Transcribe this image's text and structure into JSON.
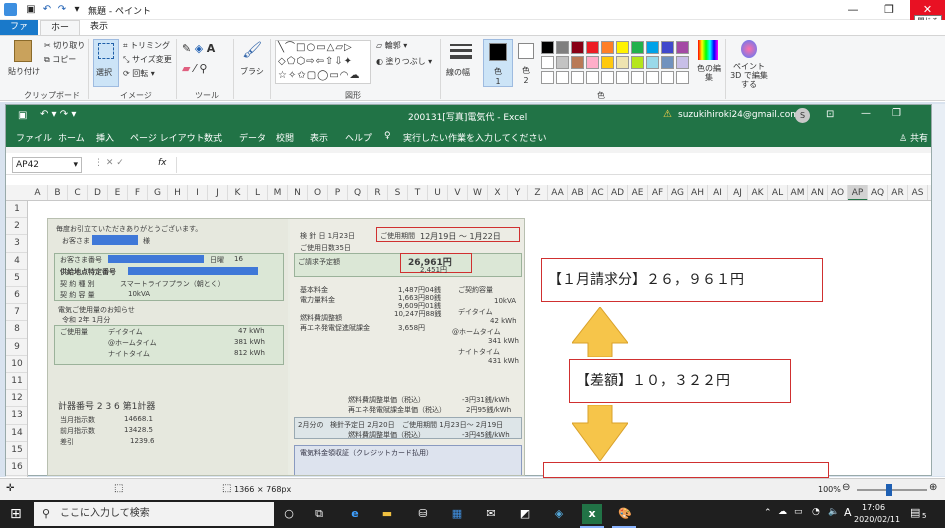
{
  "paint": {
    "title": "無題 - ペイント",
    "close_tooltip": "閉じる",
    "tabs": [
      "ファイル",
      "ホーム",
      "表示"
    ],
    "clipboard": {
      "paste": "貼り付け",
      "cut": "切り取り",
      "copy": "コピー",
      "group": "クリップボード"
    },
    "image": {
      "select": "選択",
      "crop": "トリミング",
      "resize": "サイズ変更",
      "rotate": "回転",
      "group": "イメージ"
    },
    "tools": {
      "group": "ツール"
    },
    "brushes": {
      "label": "ブラシ"
    },
    "shapes": {
      "outline": "輪郭",
      "fill": "塗りつぶし",
      "group": "図形"
    },
    "size": {
      "label": "線の幅"
    },
    "colors": {
      "color1": "色 1",
      "color2": "色 2",
      "edit": "色の編集",
      "paint3d": "ペイント 3D で編集する",
      "group": "色",
      "palette_row1": [
        "#000000",
        "#7f7f7f",
        "#880015",
        "#ed1c24",
        "#ff7f27",
        "#fff200",
        "#22b14c",
        "#00a2e8",
        "#3f48cc",
        "#a349a4"
      ],
      "palette_row2": [
        "#ffffff",
        "#c3c3c3",
        "#b97a57",
        "#ffaec9",
        "#ffc90e",
        "#efe4b0",
        "#b5e61d",
        "#99d9ea",
        "#7092be",
        "#c8bfe7"
      ]
    },
    "status": {
      "dimensions": "1366 × 768px",
      "zoom": "100%"
    }
  },
  "excel": {
    "title": "200131[写真]電気代 - Excel",
    "account": "suzukihiroki24@gmail.com",
    "avatar": "S",
    "menu": [
      "ファイル",
      "ホーム",
      "挿入",
      "ページ レイアウト",
      "数式",
      "データ",
      "校閲",
      "表示",
      "ヘルプ"
    ],
    "tell_me": "実行したい作業を入力してください",
    "share": "共有",
    "name_box": "AP42",
    "fx": "fx",
    "columns": [
      "A",
      "B",
      "C",
      "D",
      "E",
      "F",
      "G",
      "H",
      "I",
      "J",
      "K",
      "L",
      "M",
      "N",
      "O",
      "P",
      "Q",
      "R",
      "S",
      "T",
      "U",
      "V",
      "W",
      "X",
      "Y",
      "Z",
      "AA",
      "AB",
      "AC",
      "AD",
      "AE",
      "AF",
      "AG",
      "AH",
      "AI",
      "AJ",
      "AK",
      "AL",
      "AM",
      "AN",
      "AO",
      "AP",
      "AQ",
      "AR",
      "AS"
    ],
    "rows": [
      "1",
      "2",
      "3",
      "4",
      "5",
      "6",
      "7",
      "8",
      "9",
      "10",
      "11",
      "12",
      "13",
      "14",
      "15",
      "16"
    ],
    "notes": {
      "jan": "【１月請求分】２６，９６１円",
      "diff": "【差額】１０，３２２円"
    }
  },
  "bill": {
    "greeting": "毎度お引立ていただきありがとうございます。",
    "customer": "お客さま",
    "sama": "様",
    "customer_no": "お客さま番号",
    "meter_label": "日曜",
    "meter_no": "16",
    "supply_no": "供給地点特定番号",
    "contract_type": "契 約 種 別",
    "plan": "スマートライフプラン（朝とく）",
    "contract_cap": "契 約 容 量",
    "cap_value": "10kVA",
    "usage_notice": "電気ご使用量のお知らせ",
    "month_label": "令和 2年 1月分",
    "usage": "ご使用量",
    "daytime": "デイタイム",
    "daytime_kwh": "47 kWh",
    "hometime": "@ホームタイム",
    "hometime_kwh": "381 kWh",
    "night": "ナイトタイム",
    "night_kwh": "812 kWh",
    "meter_title": "計器番号 2 3 6  第1計器",
    "this_reading": "当月指示数",
    "this_value": "14668.1",
    "prev_reading": "前月指示数",
    "prev_value": "13428.5",
    "diff_label": "差引",
    "diff_value": "1239.6",
    "check_date": "検 針 日  1月23日",
    "period_label": "ご使用期間",
    "period": "12月19日 ～ 1月22日",
    "days": "ご使用日数35日",
    "billed_label": "ご請求予定額",
    "billed": "26,961円",
    "tax": "2,451円",
    "basic": "基本料金",
    "energy": "電力量料金",
    "fuel": "燃料費調整額",
    "renew": "再エネ発電促進賦課金",
    "renew_value": "3,658円",
    "v1": "1,487円04銭",
    "v2": "1,663円80銭",
    "v3": "9,609円01銭",
    "v4": "10,247円88銭",
    "contract_cap2": "ご契約容量",
    "cap2": "10kVA",
    "day2": "デイタイム",
    "day2_kwh": "42 kWh",
    "home2": "@ホームタイム",
    "home2_kwh": "341 kWh",
    "night2": "ナイトタイム",
    "night2_kwh": "431 kWh",
    "fuel_unit": "燃料費調整単価（税込）",
    "fuel_unit_val": "-3円31銭/kWh",
    "renew_unit": "再エネ発電賦課金単価（税込）",
    "renew_unit_val": "2円95銭/kWh",
    "next_month": "2月分の",
    "next_date": "検針予定日  2月20日",
    "next_period": "ご使用期間  1月23日～ 2月19日",
    "next_fuel": "燃料費調整単価（税込）",
    "next_fuel_val": "-3円45銭/kWh",
    "card": "電気料金領収証（クレジットカード払用）"
  },
  "taskbar": {
    "search": "ここに入力して検索",
    "time": "17:06",
    "date": "2020/02/11",
    "ime": "A",
    "notifications": "5"
  }
}
